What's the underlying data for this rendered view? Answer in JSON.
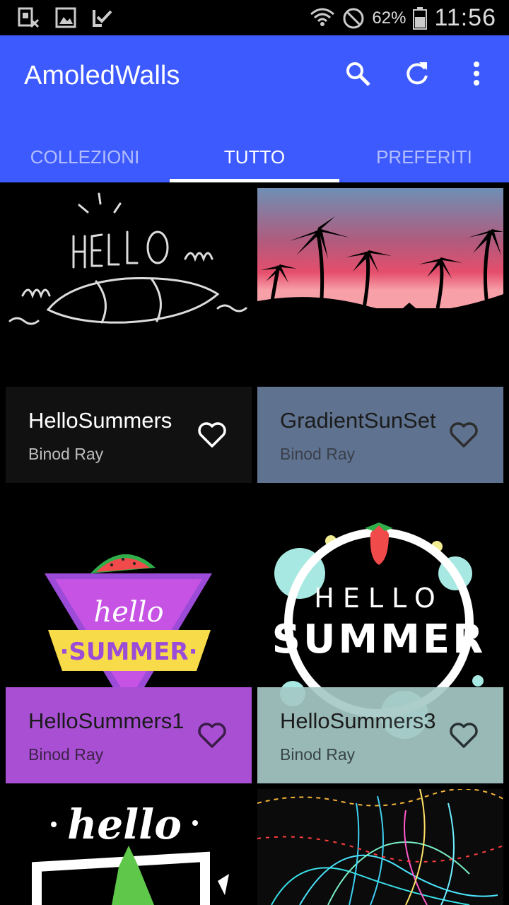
{
  "status_bar": {
    "battery": "62%",
    "time": "11:56",
    "icons": [
      "sim-x-icon",
      "image-icon",
      "check-clipboard-icon",
      "wifi-icon",
      "do-not-disturb-icon",
      "battery-icon"
    ]
  },
  "app": {
    "title": "AmoledWalls",
    "actions": [
      "search-icon",
      "refresh-icon",
      "more-vert-icon"
    ],
    "accent": "#3d5afe"
  },
  "tabs": [
    {
      "label": "COLLEZIONI",
      "active": false
    },
    {
      "label": "TUTTO",
      "active": true
    },
    {
      "label": "PREFERITI",
      "active": false
    }
  ],
  "wallpapers": [
    {
      "title": "HelloSummers",
      "author": "Binod Ray",
      "caption_bg": "#111111",
      "text_color": "#ffffff",
      "sub_color": "#bdbdbd",
      "heart_color": "#ffffff"
    },
    {
      "title": "GradientSunSet",
      "author": "Binod Ray",
      "caption_bg": "#5f7391",
      "text_color": "#1c1c1c",
      "sub_color": "#3a3f4a",
      "heart_color": "#2d2d2d"
    },
    {
      "title": "HelloSummers1",
      "author": "Binod Ray",
      "caption_bg": "#a94fd3",
      "text_color": "#1a1a1a",
      "sub_color": "#3d2248",
      "heart_color": "#3a1c48"
    },
    {
      "title": "HelloSummers3",
      "author": "Binod Ray",
      "caption_bg": "#a5c9c6",
      "text_color": "#1e1e1e",
      "sub_color": "#3e4d4c",
      "heart_color": "#2a3635"
    }
  ]
}
